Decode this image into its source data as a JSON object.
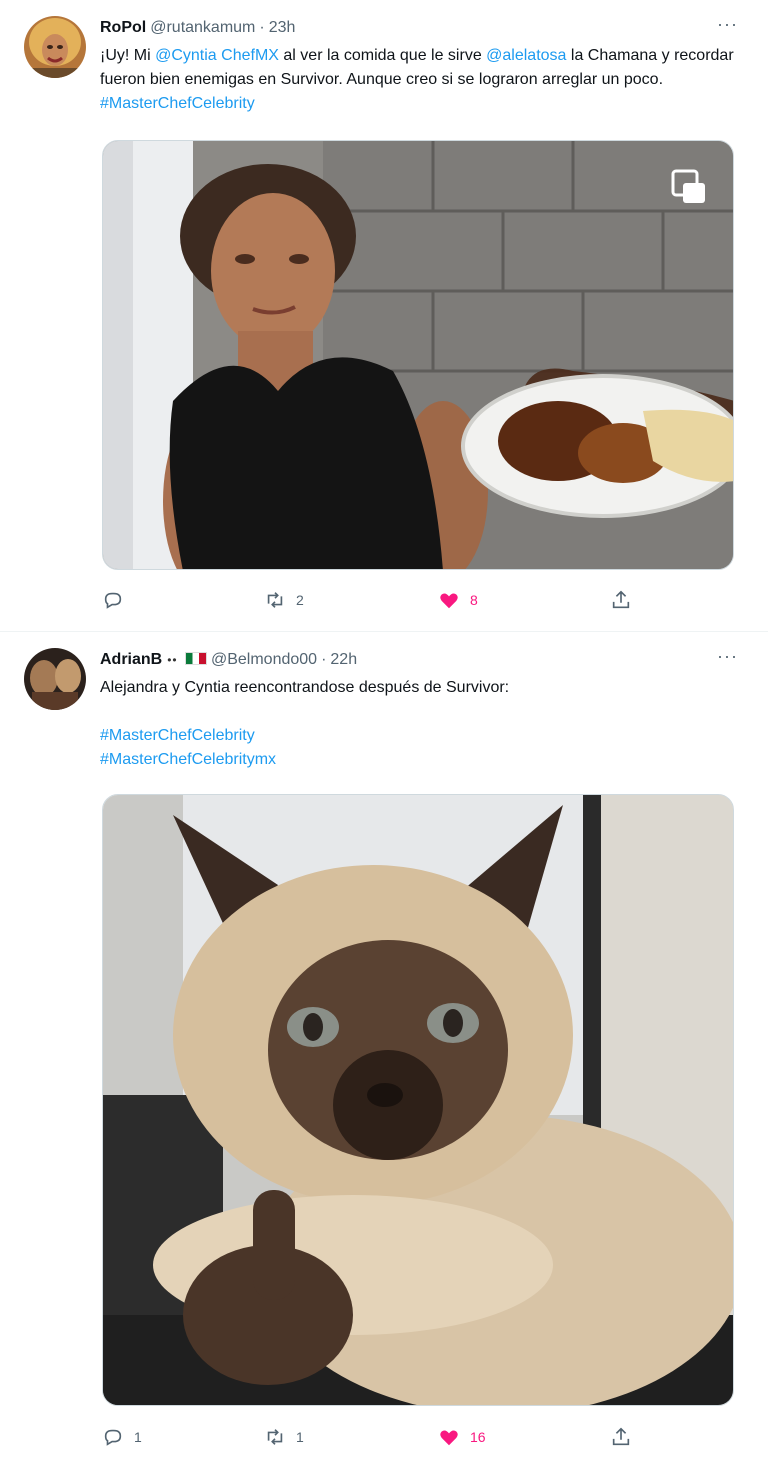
{
  "tweets": [
    {
      "display_name": "RoPol",
      "handle": "@rutankamum",
      "separator": "·",
      "time": "23h",
      "more_icon": "more-horizontal-icon",
      "text_segments": [
        {
          "t": "¡Uy! Mi ",
          "link": false
        },
        {
          "t": "@Cyntia ChefMX",
          "link": true
        },
        {
          "t": " al ver la comida que le sirve ",
          "link": false
        },
        {
          "t": "@alelatosa",
          "link": true
        },
        {
          "t": " la Chamana y recordar fueron bien enemigas en Survivor. Aunque creo si se lograron arreglar un poco. ",
          "link": false
        },
        {
          "t": "#MasterChefCelebrity",
          "link": true
        }
      ],
      "media_icon": "gallery-icon",
      "replies": "",
      "retweets": "2",
      "likes": "8"
    },
    {
      "display_name": "AdrianB",
      "flags": "•• ",
      "handle": "@Belmondo00",
      "separator": "·",
      "time": "22h",
      "more_icon": "more-horizontal-icon",
      "line1": "Alejandra y Cyntia reencontrandose después de Survivor:",
      "hashtag1": "#MasterChefCelebrity",
      "hashtag2": "#MasterChefCelebritymx",
      "replies": "1",
      "retweets": "1",
      "likes": "16"
    }
  ],
  "colors": {
    "link": "#1d9bf0",
    "like": "#f91880",
    "muted": "#536471"
  }
}
